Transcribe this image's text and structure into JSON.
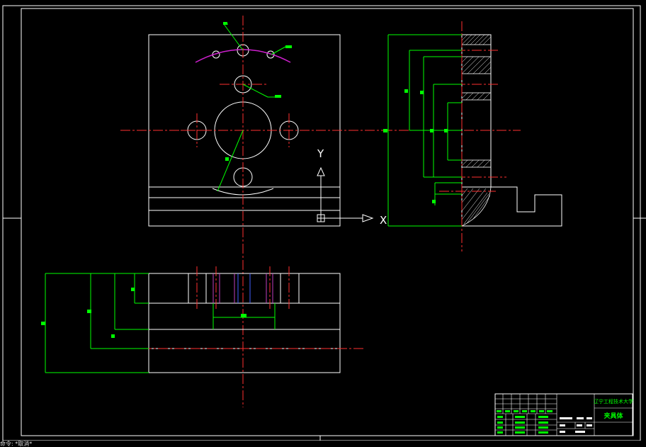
{
  "viewport": {
    "axis_labels": {
      "x": "X",
      "y": "Y"
    }
  },
  "title_block": {
    "school": "辽宁工程技术大学",
    "drawing_name": "夹具体"
  },
  "command_line": {
    "text": "命令: *取消*"
  },
  "colors": {
    "background": "#000000",
    "geometry": "#ffffff",
    "centerline": "#ff3030",
    "dimension": "#00ff00",
    "arc": "#d020d0",
    "hidden": "#c040c0",
    "blue": "#4060ff"
  }
}
